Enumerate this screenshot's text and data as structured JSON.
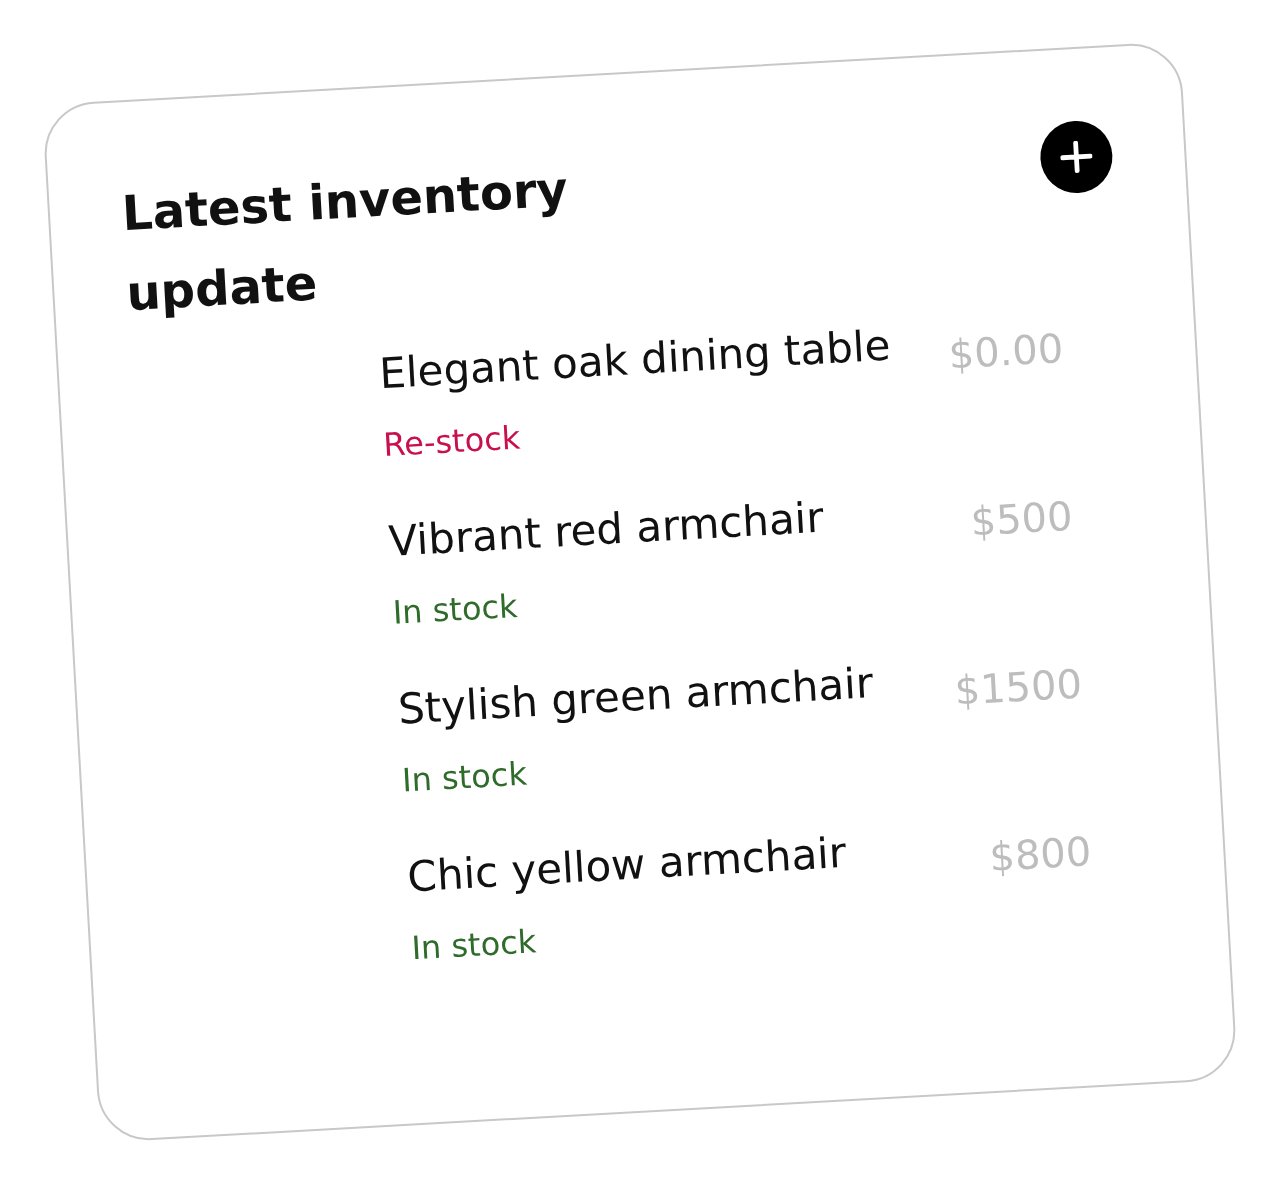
{
  "title": "Latest inventory update",
  "items": [
    {
      "name": "Elegant oak dining table",
      "status": "Re-stock",
      "color": "#c8104f",
      "price": "$0.00"
    },
    {
      "name": "Vibrant red armchair",
      "status": "In stock",
      "color": "#2f6b2a",
      "price": "$500"
    },
    {
      "name": "Stylish green armchair",
      "status": "In stock",
      "color": "#2f6b2a",
      "price": "$1500"
    },
    {
      "name": "Chic yellow armchair",
      "status": "In stock",
      "color": "#2f6b2a",
      "price": "$800"
    }
  ]
}
